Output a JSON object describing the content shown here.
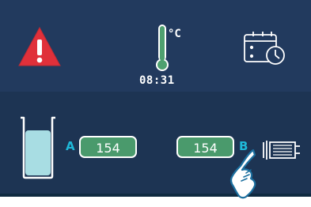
{
  "status": {
    "temperature_unit": "°C",
    "time": "08:31"
  },
  "tanks": {
    "a": {
      "letter": "A",
      "value": "154"
    },
    "b": {
      "letter": "B",
      "value": "154"
    }
  },
  "icons": {
    "warning": "warning-triangle-icon",
    "thermometer": "thermometer-icon",
    "schedule": "calendar-clock-icon",
    "beaker": "beaker-icon",
    "cassette": "cassette-icon",
    "pointer": "hand-pointer-icon"
  },
  "colors": {
    "panel_top": "#223a5e",
    "panel_bottom": "#1d3453",
    "warning_red": "#e0303a",
    "thermometer_green": "#4ea06f",
    "value_green": "#4a9a6c",
    "accent_cyan": "#1fb8d8"
  }
}
